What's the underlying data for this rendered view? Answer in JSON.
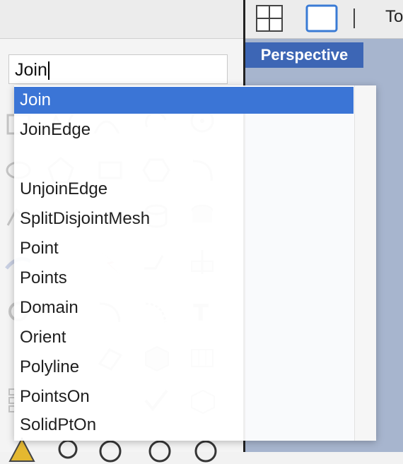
{
  "command_input": {
    "value": "Join"
  },
  "toolbar": {
    "text_fragment": "To"
  },
  "viewport": {
    "active_tab": "Perspective"
  },
  "autocomplete": {
    "selected_index": 0,
    "items": [
      "Join",
      "JoinEdge",
      "",
      "UnjoinEdge",
      "SplitDisjointMesh",
      "Point",
      "Points",
      "Domain",
      "Orient",
      "Polyline",
      "PointsOn",
      "SolidPtOn"
    ]
  },
  "colors": {
    "selection": "#3b75d6",
    "viewport_bg": "#a7b5ce",
    "tab_bg": "#3d66b5"
  }
}
